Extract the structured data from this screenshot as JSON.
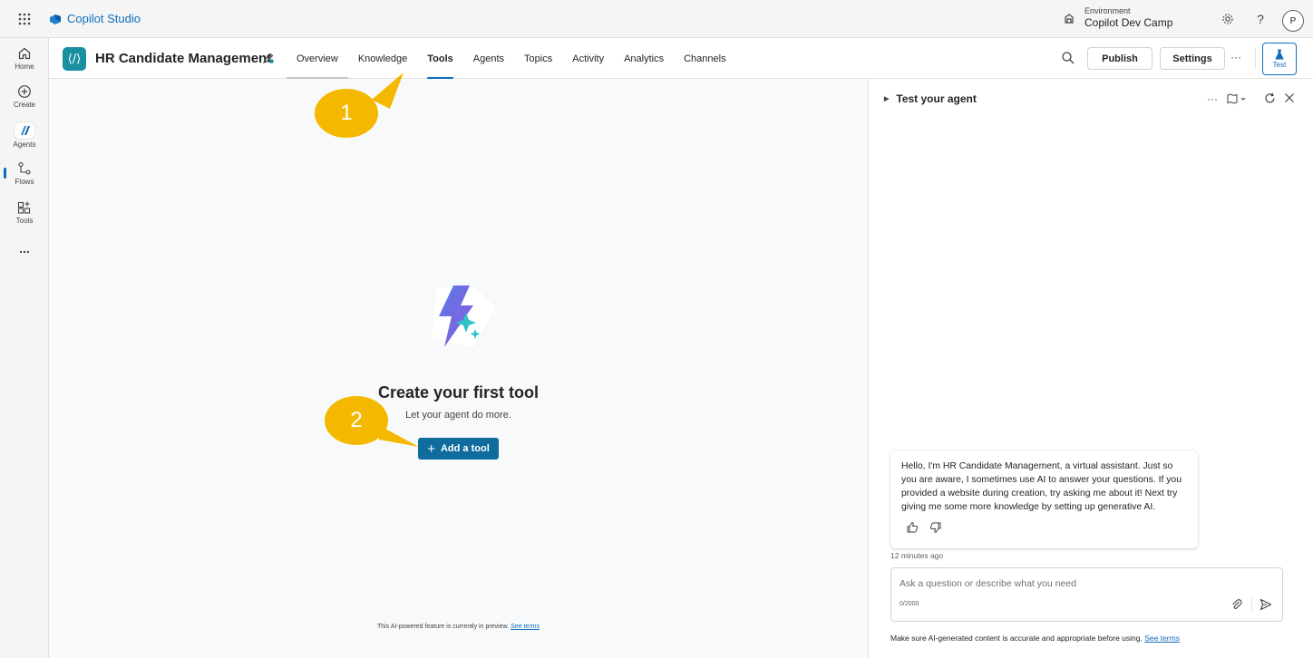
{
  "app": {
    "name": "Copilot Studio",
    "environment_label": "Environment",
    "environment_name": "Copilot Dev Camp",
    "user_initial": "P"
  },
  "rail": {
    "items": [
      {
        "label": "Home",
        "icon": "home-icon"
      },
      {
        "label": "Create",
        "icon": "plus-circle-icon"
      },
      {
        "label": "Agents",
        "icon": "agents-icon"
      },
      {
        "label": "Flows",
        "icon": "flows-icon"
      },
      {
        "label": "Tools",
        "icon": "tools-icon"
      }
    ],
    "more": "..."
  },
  "agent": {
    "name": "HR Candidate Management",
    "tabs": [
      "Overview",
      "Knowledge",
      "Tools",
      "Agents",
      "Topics",
      "Activity",
      "Analytics",
      "Channels"
    ],
    "active_tab": "Tools",
    "publish_label": "Publish",
    "settings_label": "Settings",
    "more": "···",
    "test_label": "Test"
  },
  "main": {
    "title": "Create your first tool",
    "subtitle": "Let your agent do more.",
    "add_tool_label": "Add a tool",
    "preview_note": "This AI-powered feature is currently in preview.",
    "see_terms": "See terms"
  },
  "callouts": [
    "1",
    "2"
  ],
  "test_panel": {
    "title": "Test your agent",
    "message": "Hello, I'm HR Candidate Management, a virtual assistant. Just so you are aware, I sometimes use AI to answer your questions. If you provided a website during creation, try asking me about it! Next try giving me some more knowledge by setting up generative AI.",
    "timestamp": "12 minutes ago",
    "input_placeholder": "Ask a question or describe what you need",
    "char_count": "0/2000",
    "disclaimer": "Make sure AI-generated content is accurate and appropriate before using.",
    "see_terms": "See terms"
  },
  "colors": {
    "accent": "#0f6cbd",
    "primary_button": "#0f6c9d",
    "callout": "#f5b800",
    "agent_logo": "#1a8fa0"
  }
}
